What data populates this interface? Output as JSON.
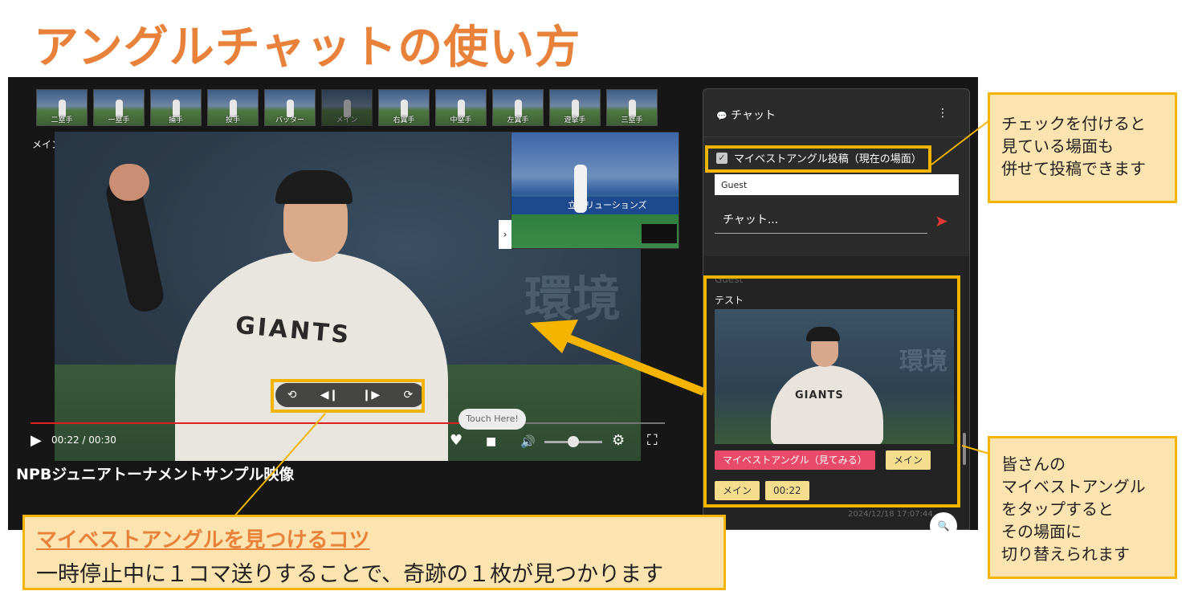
{
  "slide": {
    "title": "アングルチャットの使い方"
  },
  "angles": [
    {
      "label": "二塁手"
    },
    {
      "label": "一塁手"
    },
    {
      "label": "捕手"
    },
    {
      "label": "投手"
    },
    {
      "label": "バッター"
    },
    {
      "label": "メイン"
    },
    {
      "label": "右翼手"
    },
    {
      "label": "中堅手"
    },
    {
      "label": "左翼手"
    },
    {
      "label": "遊撃手"
    },
    {
      "label": "三塁手"
    }
  ],
  "player": {
    "current_angle_label": "メイン",
    "overlay_text": "環境",
    "jersey_text": "GIANTS",
    "pip_banner": "立ソリューションズ",
    "pip_toggle": "›",
    "time_current": "00:22",
    "time_total": "00:30",
    "time_display": "00:22 / 00:30",
    "progress": 0.7,
    "volume": 0.5,
    "touch_hint": "Touch Here!",
    "icons": {
      "play": "▶",
      "replay_back": "⟲",
      "frame_back": "◀❙",
      "frame_forward": "❙▶",
      "replay_forward": "⟳",
      "heart": "♥",
      "camera": "■",
      "volume": "🔊",
      "settings": "⚙",
      "fullscreen": "⛶"
    }
  },
  "video": {
    "title": "NPBジュニアトーナメントサンプル映像"
  },
  "chat": {
    "title": "チャット",
    "title_icon": "💬",
    "menu_icon": "⋮",
    "checkbox_label": "マイベストアングル投稿（現在の場面）",
    "checkbox_checked": true,
    "checkmark": "✓",
    "name_value": "Guest",
    "input_placeholder": "チャット...",
    "send_icon": "➤",
    "message": {
      "user": "Guest",
      "text": "テスト",
      "image_jersey": "GIANTS",
      "image_bg_text": "環境",
      "chips": [
        "マイベストアングル（見てみる）",
        "メイン",
        "メイン",
        "00:22"
      ],
      "timestamp": "2024/12/18 17:07:44"
    },
    "search_icon": "🔍"
  },
  "annotations": {
    "checkbox_note": [
      "チェックを付けると",
      "見ている場面も",
      "併せて投稿できます"
    ],
    "angle_note": [
      "皆さんの",
      "マイベストアングル",
      "をタップすると",
      "その場面に",
      "切り替えられます"
    ],
    "tip_title": "マイベストアングルを見つけるコツ",
    "tip_body": "一時停止中に１コマ送りすることで、奇跡の１枚が見つかります",
    "accent_color": "#e8823a",
    "highlight_color": "#f4b400"
  }
}
